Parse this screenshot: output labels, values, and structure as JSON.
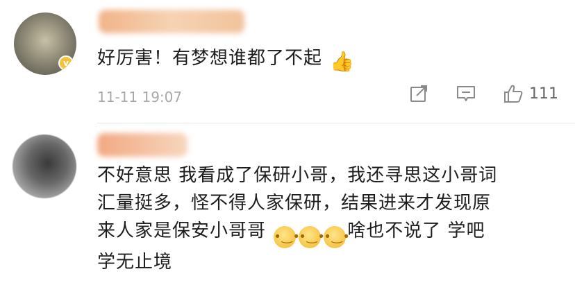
{
  "comments": [
    {
      "text": "好厉害！有梦想谁都了不起",
      "emoji_end": "👍",
      "time": "11-11 19:07",
      "like_count": "111"
    },
    {
      "line1": "不好意思 我看成了保研小哥，我还寻思这小哥词",
      "line2": "汇量挺多，怪不得人家保研，结果进来才发现原",
      "line3a": "来人家是保安小哥哥",
      "line3b": "啥也不说了 学吧",
      "line4": "学无止境"
    }
  ],
  "icons": {
    "avatar_badge": "v-badge-icon",
    "thumb": "thumbs-up-emoji",
    "thinking": "thinking-face-emoji",
    "repost": "repost-icon",
    "reply": "comment-icon",
    "like": "like-icon"
  },
  "colors": {
    "timestamp": "#a8a8a8",
    "text": "#1d1d1d",
    "icon": "#8a8a8a"
  }
}
